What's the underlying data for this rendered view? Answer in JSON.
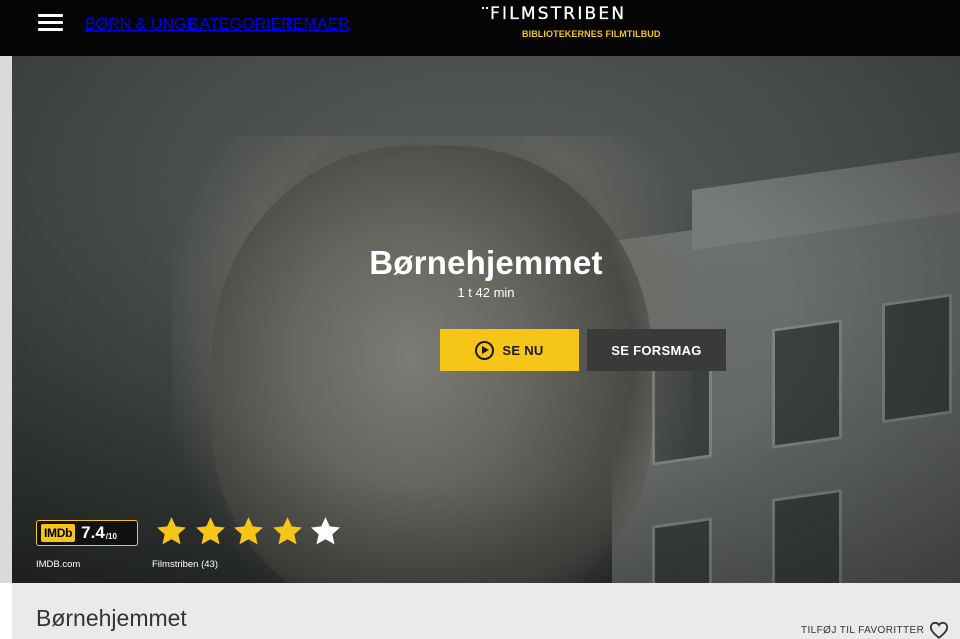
{
  "header": {
    "menu_icon": "hamburger-menu-icon",
    "nav": [
      "BØRN & UNGE",
      "KATEGORIER",
      "TEMAER"
    ],
    "logo_text": "FILMSTRIBEN",
    "logo_tagline": "BIBLIOTEKERNES FILMTILBUD"
  },
  "hero": {
    "title": "Børnehjemmet",
    "duration": "1 t 42 min",
    "play_label": "SE NU",
    "play_icon": "play-circle-icon",
    "trailer_label": "SE FORSMAG"
  },
  "ratings": {
    "imdb_logo": "IMDb",
    "imdb_score": "7.4",
    "imdb_max": "/10",
    "imdb_source": "IMDB.com",
    "filmstriben_stars": 4,
    "filmstriben_max_stars": 5,
    "filmstriben_source": "Filmstriben (43)"
  },
  "info": {
    "title": "Børnehjemmet",
    "favorite_label": "TILFØJ TIL FAVORITTER",
    "favorite_icon": "heart-outline-icon"
  },
  "colors": {
    "accent": "#f5c518",
    "header_bg": "#050505",
    "secondary_button": "#3a3a3a",
    "info_bg": "#eaeaea"
  }
}
